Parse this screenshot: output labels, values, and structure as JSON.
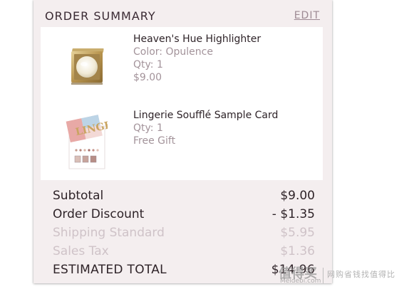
{
  "header": {
    "title": "ORDER SUMMARY",
    "edit_label": "EDIT"
  },
  "items": [
    {
      "name": "Heaven's Hue Highlighter",
      "details": [
        "Color: Opulence",
        "Qty: 1",
        "$9.00"
      ],
      "icon": "compact-highlighter-image"
    },
    {
      "name": "Lingerie Soufflé Sample Card",
      "details": [
        "Qty: 1",
        "Free Gift"
      ],
      "icon": "sample-card-image"
    }
  ],
  "totals": {
    "subtotal": {
      "label": "Subtotal",
      "value": "$9.00"
    },
    "discount": {
      "label": "Order Discount",
      "value": "- $1.35"
    },
    "shipping": {
      "label": "Shipping Standard",
      "value": "$5.95"
    },
    "tax": {
      "label": "Sales Tax",
      "value": "$1.36"
    },
    "estimated": {
      "label": "ESTIMATED TOTAL",
      "value": "$14.96"
    }
  },
  "watermark": {
    "brand": "值得买",
    "site": "Meidebi.com",
    "slogan": "网购省钱找值得比"
  },
  "colors": {
    "panel_bg": "#f4eeef",
    "text_dark": "#2e2328",
    "text_muted": "#a3939a",
    "text_faded": "#cfc3c8",
    "link": "#9d8a93"
  }
}
